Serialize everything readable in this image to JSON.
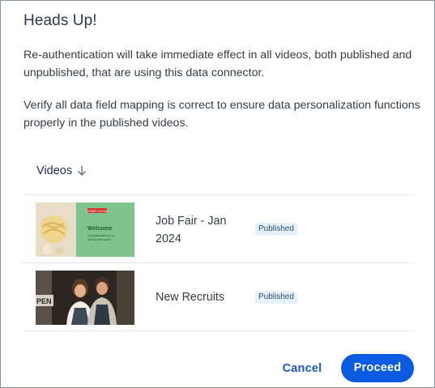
{
  "dialog": {
    "title": "Heads Up!",
    "message_1": "Re-authentication will take immediate effect in all videos, both published and unpublished, that are using this data connector.",
    "message_2": "Verify all data field mapping is correct to ensure data personalization functions properly in the published videos."
  },
  "table": {
    "column_header": "Videos",
    "sort_icon": "arrow-down-icon",
    "rows": [
      {
        "name": "Job Fair - Jan 2024",
        "status": "Published",
        "thumbnail_text": [
          "HOME LOCAL",
          "Welcome",
          "Congratulations on",
          "joining the team!"
        ]
      },
      {
        "name": "New Recruits",
        "status": "Published",
        "thumbnail_text": [
          "PEN"
        ]
      }
    ]
  },
  "actions": {
    "cancel_label": "Cancel",
    "proceed_label": "Proceed"
  },
  "colors": {
    "primary": "#0a5be0",
    "link": "#1b56c8",
    "badge_bg": "#e6f2fb",
    "badge_text": "#2d4a68",
    "divider": "#e2e6ee"
  }
}
